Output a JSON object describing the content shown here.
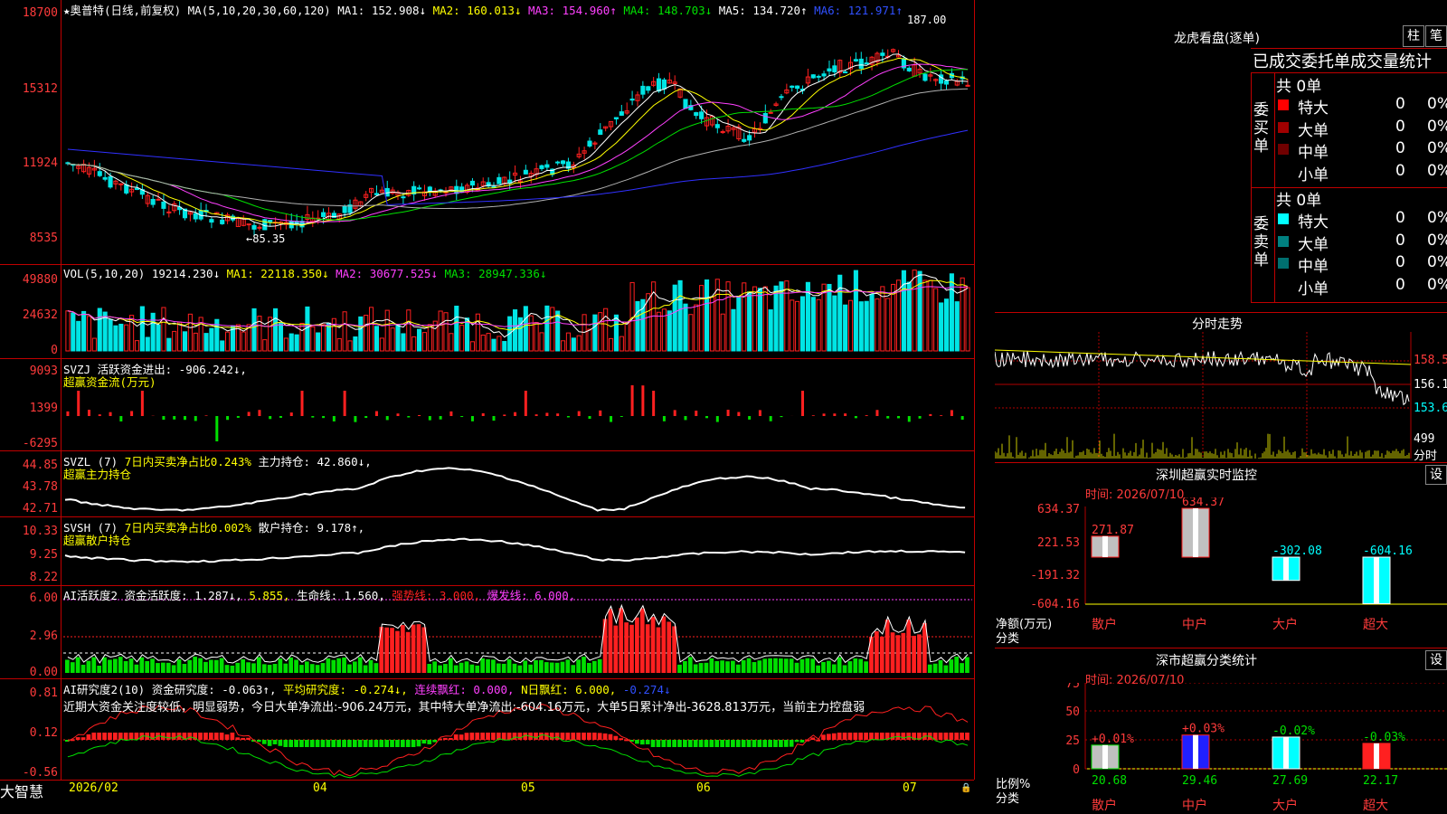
{
  "colors": {
    "up": "#ff2020",
    "down": "#00e5e5",
    "cyan": "#00ffff",
    "yellow": "#ffff00",
    "magenta": "#ff40ff",
    "green": "#00e000",
    "white": "#ffffff",
    "blue": "#3030ff",
    "gray": "#b0b0b0",
    "grid": "#b00000"
  },
  "header": {
    "title": "★奥普特(日线,前复权)",
    "ma_label": "MA(5,10,20,30,60,120)",
    "ma1": "MA1: 152.908↓",
    "ma2": "MA2: 160.013↓",
    "ma3": "MA3: 154.960↑",
    "ma4": "MA4: 148.703↓",
    "ma5": "MA5: 134.720↑",
    "ma6": "MA6: 121.971↑"
  },
  "price": {
    "y_ticks": [
      "18700",
      "15312",
      "11924",
      "8535"
    ],
    "high_label": "187.00",
    "low_label": "←85.35"
  },
  "vol": {
    "header": "VOL(5,10,20)",
    "vol": "19214.230↓",
    "ma1": "MA1: 22118.350↓",
    "ma2": "MA2: 30677.525↓",
    "ma3": "MA3: 28947.336↓",
    "y_ticks": [
      "49880",
      "24632",
      "0"
    ]
  },
  "svzj": {
    "line1": "SVZJ  活跃资金进出: -906.242↓,",
    "line2": "超赢资金流(万元)",
    "y_ticks": [
      "9093",
      "1399",
      "-6295"
    ]
  },
  "svzl": {
    "h1": "SVZL (7)",
    "h2": "7日内买卖净占比0.243%",
    "h3": "主力持仓: 42.860↓,",
    "line2": "超赢主力持仓",
    "y_ticks": [
      "44.85",
      "43.78",
      "42.71"
    ]
  },
  "svsh": {
    "h1": "SVSH (7)",
    "h2": "7日内买卖净占比0.002%",
    "h3": "散户持仓: 9.178↑,",
    "line2": "超赢散户持仓",
    "y_ticks": [
      "10.33",
      "9.25",
      "8.22"
    ]
  },
  "ai1": {
    "h1": "AI活跃度2",
    "h2": "资金活跃度: 1.287↓,",
    "h3": "5.855,",
    "h4": "生命线: 1.560,",
    "h5": "强势线: 3.000,",
    "h6": "爆发线: 6.000,",
    "y_ticks": [
      "6.00",
      "2.96",
      "0.00"
    ]
  },
  "ai2": {
    "h1": "AI研究度2(10)",
    "h2": "资金研究度: -0.063↑,",
    "h3": "平均研究度: -0.274↓,",
    "h4": "连续飘红: 0.000,",
    "h5": "N日飘红: 6.000,",
    "h6": "-0.274↓",
    "comment": "近期大资金关注度较低，明显弱势，今日大单净流出:-906.24万元，其中特大单净流出:-604.16万元，大单5日累计净出-3628.813万元，当前主力控盘弱",
    "y_ticks": [
      "0.81",
      "0.12",
      "-0.56"
    ]
  },
  "bottom": {
    "brand": "大智慧",
    "dates": [
      "2026/02",
      "04",
      "05",
      "06",
      "07"
    ]
  },
  "dragon": {
    "title": "龙虎看盘(逐单)",
    "btn1": "柱",
    "btn2": "笔",
    "subtitle": "已成交委托单成交量统计",
    "buy_label": "委买单",
    "sell_label": "委卖单",
    "buy_total": "共 0单",
    "sell_total": "共 0单",
    "buy_rows": [
      {
        "name": "特大",
        "qty": "0",
        "pct": "0%",
        "color": "#ff0000"
      },
      {
        "name": "大单",
        "qty": "0",
        "pct": "0%",
        "color": "#a00000"
      },
      {
        "name": "中单",
        "qty": "0",
        "pct": "0%",
        "color": "#700000"
      },
      {
        "name": "小单",
        "qty": "0",
        "pct": "0%",
        "color": "#000000"
      }
    ],
    "sell_rows": [
      {
        "name": "特大",
        "qty": "0",
        "pct": "0%",
        "color": "#00ffff"
      },
      {
        "name": "大单",
        "qty": "0",
        "pct": "0%",
        "color": "#008080"
      },
      {
        "name": "中单",
        "qty": "0",
        "pct": "0%",
        "color": "#006f6f"
      },
      {
        "name": "小单",
        "qty": "0",
        "pct": "0%",
        "color": "#000000"
      }
    ]
  },
  "intraday": {
    "title": "分时走势",
    "y_ticks": [
      "158.5",
      "156.1",
      "153.6"
    ],
    "vol_label": "499",
    "unit": "分时"
  },
  "monitor": {
    "title": "深圳超赢实时监控",
    "btn": "设",
    "time": "时间: 2026/07/10",
    "y_ticks": [
      "634.37",
      "221.53",
      "-191.32",
      "-604.16"
    ],
    "axis1": "净额(万元)",
    "axis2": "分类",
    "bars": [
      {
        "cat": "散户",
        "value": 271.87,
        "label": "271.87"
      },
      {
        "cat": "中户",
        "value": 634.37,
        "label": "634.37"
      },
      {
        "cat": "大户",
        "value": -302.08,
        "label": "-302.08"
      },
      {
        "cat": "超大",
        "value": -604.16,
        "label": "-604.16"
      }
    ]
  },
  "stats": {
    "title": "深市超赢分类统计",
    "btn": "设",
    "time": "时间: 2026/07/10",
    "y_ticks": [
      "75",
      "50",
      "25",
      "0"
    ],
    "axis1": "比例%",
    "axis2": "分类",
    "bars": [
      {
        "cat": "散户",
        "value": 20.68,
        "label": "20.68",
        "delta": "+0.01%"
      },
      {
        "cat": "中户",
        "value": 29.46,
        "label": "29.46",
        "delta": "+0.03%"
      },
      {
        "cat": "大户",
        "value": 27.69,
        "label": "27.69",
        "delta": "-0.02%"
      },
      {
        "cat": "超大",
        "value": 22.17,
        "label": "22.17",
        "delta": "-0.03%"
      }
    ]
  }
}
